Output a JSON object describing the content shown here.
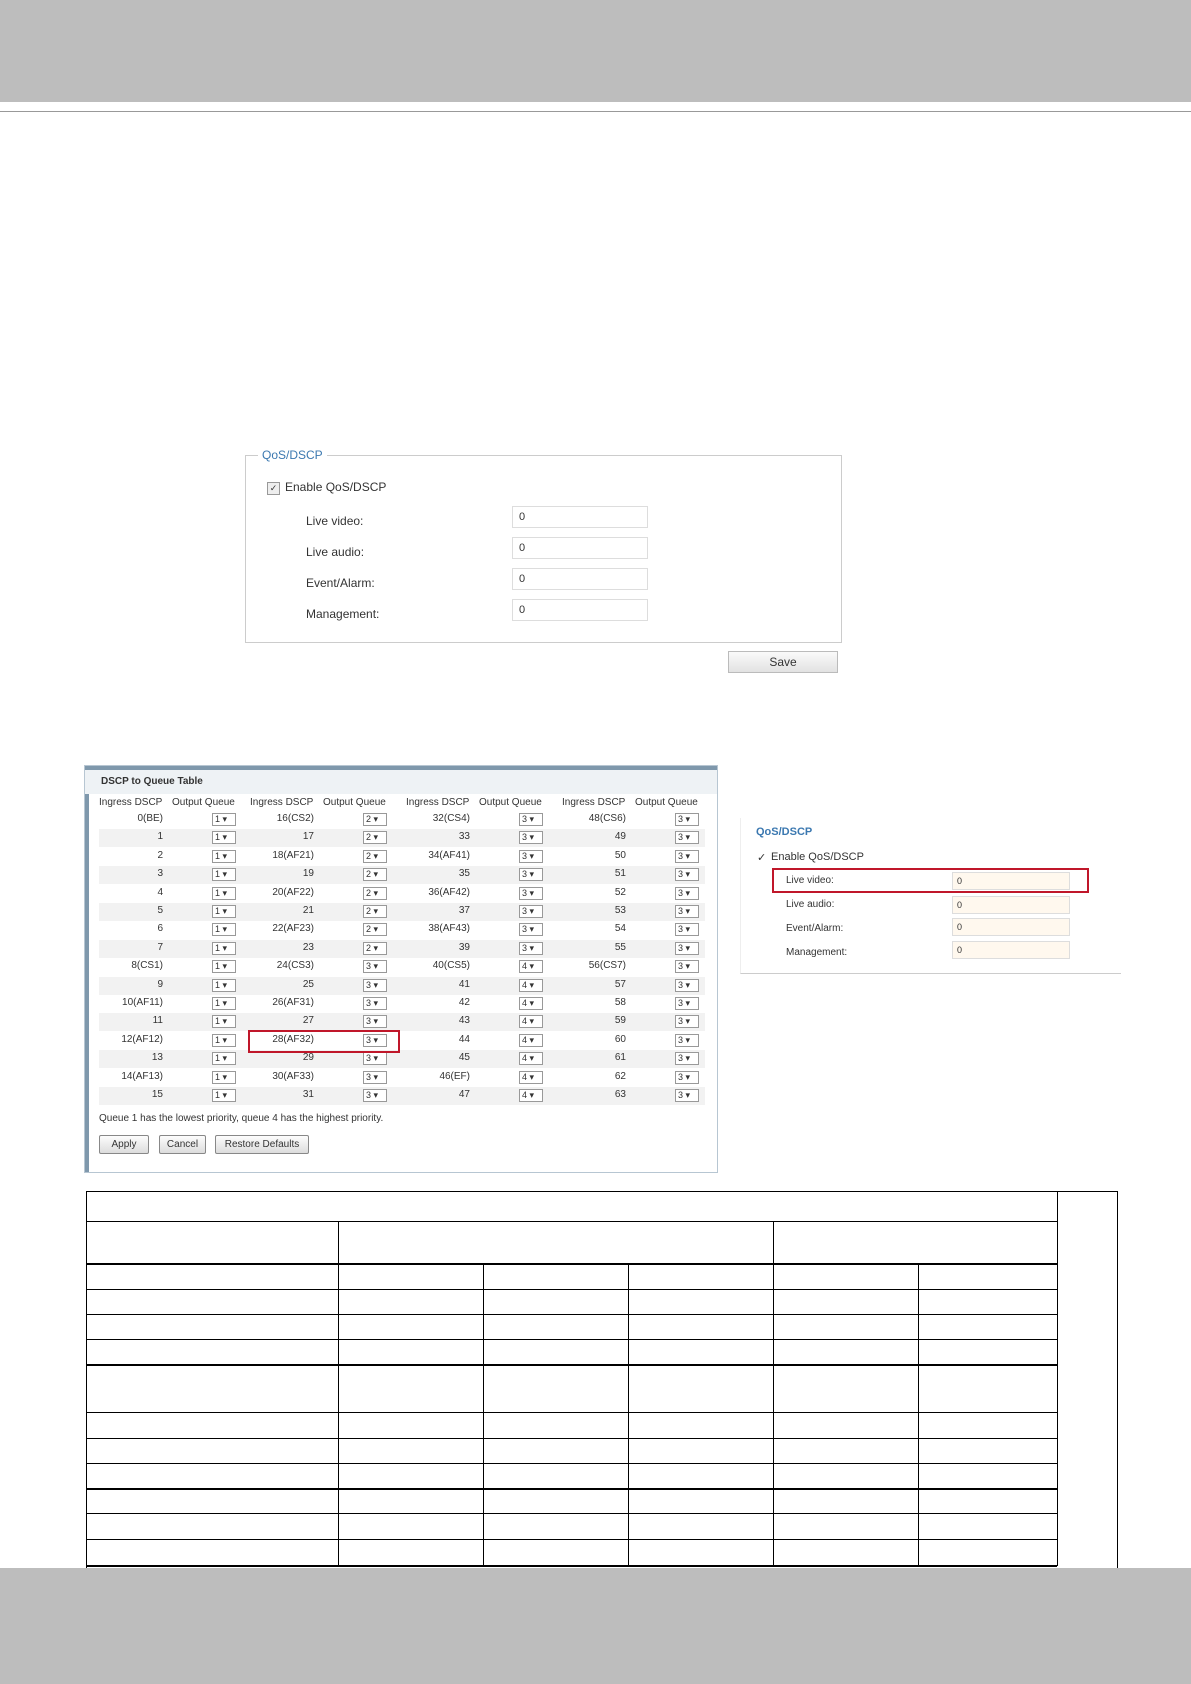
{
  "qos_panel": {
    "legend": "QoS/DSCP",
    "checkbox_mark": "✓",
    "enable_label": "Enable QoS/DSCP",
    "fields": [
      {
        "label": "Live video:",
        "value": "0"
      },
      {
        "label": "Live audio:",
        "value": "0"
      },
      {
        "label": "Event/Alarm:",
        "value": "0"
      },
      {
        "label": "Management:",
        "value": "0"
      }
    ],
    "save_label": "Save"
  },
  "dscp_table": {
    "title": "DSCP to Queue Table",
    "headers": [
      "Ingress DSCP",
      "Output Queue",
      "Ingress DSCP",
      "Output Queue",
      "Ingress DSCP",
      "Output Queue",
      "Ingress DSCP",
      "Output Queue"
    ],
    "rows": [
      [
        "0(BE)",
        "1",
        "16(CS2)",
        "2",
        "32(CS4)",
        "3",
        "48(CS6)",
        "3"
      ],
      [
        "1",
        "1",
        "17",
        "2",
        "33",
        "3",
        "49",
        "3"
      ],
      [
        "2",
        "1",
        "18(AF21)",
        "2",
        "34(AF41)",
        "3",
        "50",
        "3"
      ],
      [
        "3",
        "1",
        "19",
        "2",
        "35",
        "3",
        "51",
        "3"
      ],
      [
        "4",
        "1",
        "20(AF22)",
        "2",
        "36(AF42)",
        "3",
        "52",
        "3"
      ],
      [
        "5",
        "1",
        "21",
        "2",
        "37",
        "3",
        "53",
        "3"
      ],
      [
        "6",
        "1",
        "22(AF23)",
        "2",
        "38(AF43)",
        "3",
        "54",
        "3"
      ],
      [
        "7",
        "1",
        "23",
        "2",
        "39",
        "3",
        "55",
        "3"
      ],
      [
        "8(CS1)",
        "1",
        "24(CS3)",
        "3",
        "40(CS5)",
        "4",
        "56(CS7)",
        "3"
      ],
      [
        "9",
        "1",
        "25",
        "3",
        "41",
        "4",
        "57",
        "3"
      ],
      [
        "10(AF11)",
        "1",
        "26(AF31)",
        "3",
        "42",
        "4",
        "58",
        "3"
      ],
      [
        "11",
        "1",
        "27",
        "3",
        "43",
        "4",
        "59",
        "3"
      ],
      [
        "12(AF12)",
        "1",
        "28(AF32)",
        "3",
        "44",
        "4",
        "60",
        "3"
      ],
      [
        "13",
        "1",
        "29",
        "3",
        "45",
        "4",
        "61",
        "3"
      ],
      [
        "14(AF13)",
        "1",
        "30(AF33)",
        "3",
        "46(EF)",
        "4",
        "62",
        "3"
      ],
      [
        "15",
        "1",
        "31",
        "3",
        "47",
        "4",
        "63",
        "3"
      ]
    ],
    "note": "Queue 1 has the lowest priority, queue 4 has the highest priority.",
    "buttons": [
      "Apply",
      "Cancel",
      "Restore Defaults"
    ]
  },
  "qos_panel_small": {
    "title": "QoS/DSCP",
    "checkbox_mark": "✓",
    "enable_label": "Enable QoS/DSCP",
    "fields": [
      {
        "label": "Live video:",
        "value": "0"
      },
      {
        "label": "Live audio:",
        "value": "0"
      },
      {
        "label": "Event/Alarm:",
        "value": "0"
      },
      {
        "label": "Management:",
        "value": "0"
      }
    ]
  },
  "colors": {
    "link_blue": "#3b78b0",
    "highlight_red": "#c0172a",
    "band_gray": "#bdbdbd"
  }
}
